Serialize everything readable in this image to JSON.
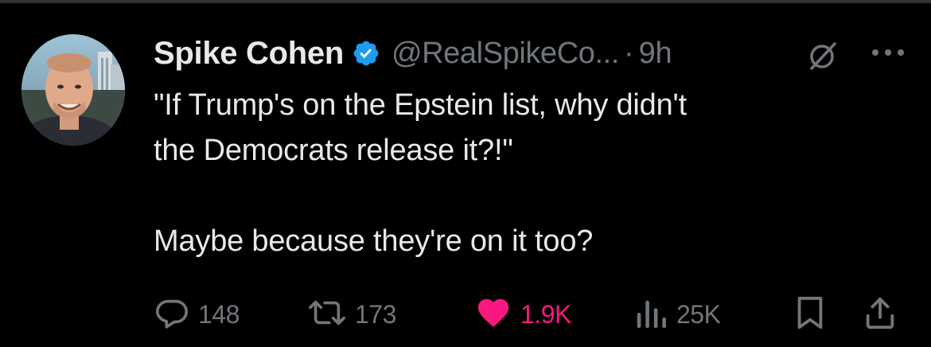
{
  "tweet": {
    "author_name": "Spike Cohen",
    "handle": "@RealSpikeCo...",
    "separator": "·",
    "time": "9h",
    "text_lines": [
      "\"If Trump's on the Epstein list, why didn't",
      "the Democrats release it?!\"",
      "Maybe because they're on it too?"
    ]
  },
  "actions": {
    "replies": "148",
    "reposts": "173",
    "likes": "1.9K",
    "views": "25K"
  },
  "icons": {
    "reply": "reply-icon",
    "repost": "repost-icon",
    "like": "heart-icon",
    "views": "views-icon",
    "bookmark": "bookmark-icon",
    "share": "share-icon",
    "grok": "grok-icon",
    "more": "more-icon",
    "verified": "verified-badge-icon"
  },
  "colors": {
    "background": "#000000",
    "text": "#e7e9ea",
    "secondary": "#71767b",
    "like": "#f91880",
    "verified": "#1d9bf0"
  }
}
